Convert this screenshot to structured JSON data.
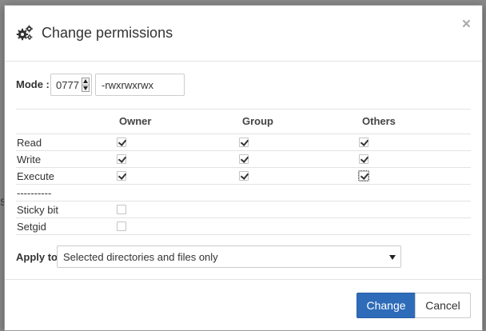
{
  "backdrop": {
    "fragment_1": "",
    "fragment_2": "S"
  },
  "dialog": {
    "title": "Change permissions",
    "close_glyph": "×",
    "icon": "gears-icon"
  },
  "mode": {
    "label": "Mode :",
    "octal": "0777",
    "symbolic": "-rwxrwxrwx"
  },
  "table": {
    "columns": [
      "Owner",
      "Group",
      "Others"
    ],
    "rows": [
      {
        "label": "Read",
        "checks": [
          true,
          true,
          true
        ]
      },
      {
        "label": "Write",
        "checks": [
          true,
          true,
          true
        ]
      },
      {
        "label": "Execute",
        "checks": [
          true,
          true,
          true
        ]
      },
      {
        "label": "----------",
        "checks": []
      },
      {
        "label": "Sticky bit",
        "checks": [
          false
        ]
      },
      {
        "label": "Setgid",
        "checks": [
          false
        ]
      }
    ]
  },
  "apply": {
    "label": "Apply to",
    "selected": "Selected directories and files only"
  },
  "buttons": {
    "change": "Change",
    "cancel": "Cancel"
  },
  "colors": {
    "primary": "#2e6cba",
    "backdrop": "#8a8a8a"
  }
}
